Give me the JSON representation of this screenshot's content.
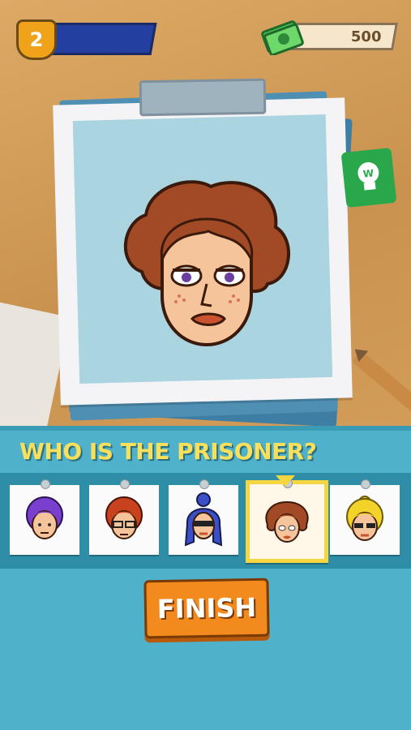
{
  "hud": {
    "level": "2",
    "money": "500",
    "level_icon": "shield-badge-icon",
    "money_icon": "cash-stack-icon"
  },
  "hint": {
    "icon": "lightbulb-hint-icon"
  },
  "question": "WHO IS THE PRISONER?",
  "suspects": [
    {
      "id": "purple-hair",
      "hair": "#7b3fd0",
      "selected": false
    },
    {
      "id": "red-hair-glasses",
      "hair": "#c8421e",
      "selected": false
    },
    {
      "id": "blue-bun-sunglasses",
      "hair": "#3b4fc8",
      "selected": false
    },
    {
      "id": "brown-curly",
      "hair": "#a14a26",
      "selected": true
    },
    {
      "id": "yellow-hair-sunglasses",
      "hair": "#f3d22a",
      "selected": false
    }
  ],
  "finish_label": "FINISH",
  "colors": {
    "panel": "#50b2ca",
    "question_text": "#f8e05c",
    "finish_button": "#f38a1e",
    "selected_border": "#f5d640"
  }
}
